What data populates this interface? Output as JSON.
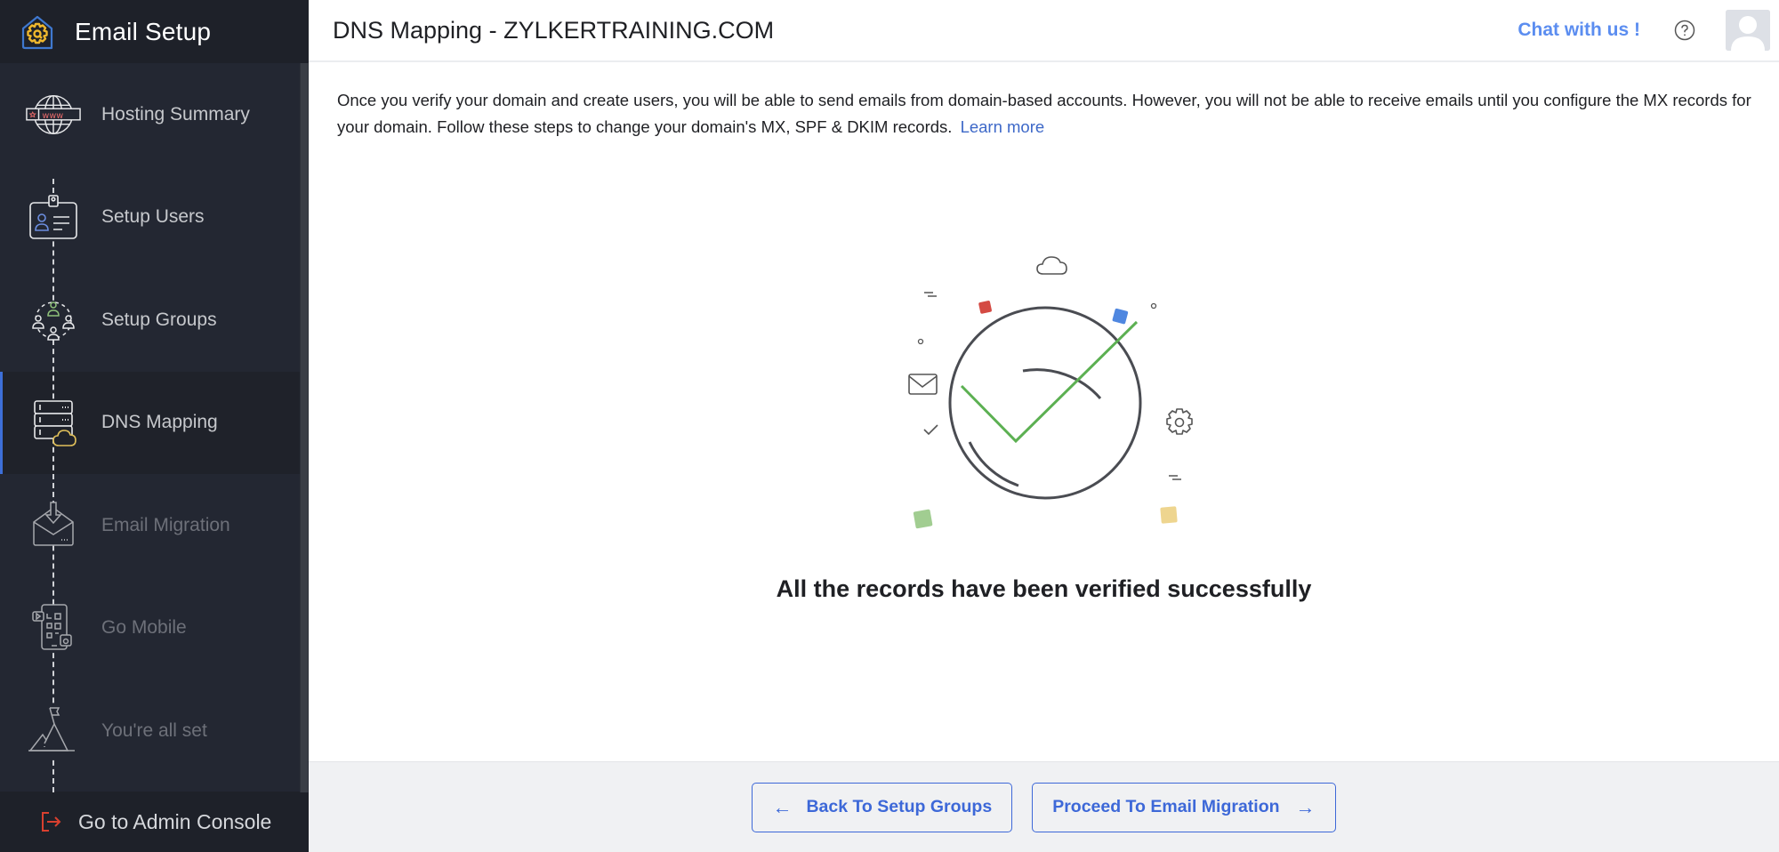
{
  "sidebar": {
    "title": "Email Setup",
    "logo_icon": "settings-home-icon",
    "steps": [
      {
        "label": "Hosting Summary",
        "icon": "globe-www-icon",
        "state": "done"
      },
      {
        "label": "Setup Users",
        "icon": "id-card-icon",
        "state": "done"
      },
      {
        "label": "Setup Groups",
        "icon": "group-users-icon",
        "state": "done"
      },
      {
        "label": "DNS Mapping",
        "icon": "server-cloud-icon",
        "state": "active"
      },
      {
        "label": "Email Migration",
        "icon": "envelope-download-icon",
        "state": "disabled"
      },
      {
        "label": "Go Mobile",
        "icon": "mobile-apps-icon",
        "state": "disabled"
      },
      {
        "label": "You're all set",
        "icon": "mountain-flag-icon",
        "state": "disabled"
      }
    ],
    "footer": {
      "label": "Go to Admin Console",
      "icon": "exit-icon"
    }
  },
  "header": {
    "title": "DNS Mapping - ZYLKERTRAINING.COM",
    "chat_label": "Chat with us !",
    "help_icon": "question-circle-icon",
    "avatar_icon": "user-avatar-icon"
  },
  "content": {
    "description": "Once you verify your domain and create users, you will be able to send emails from domain-based accounts. However, you will not be able to receive emails until you configure the MX records for your domain. Follow these steps to change your domain's MX, SPF & DKIM records.",
    "learn_more": "Learn more",
    "success_message": "All the records have been verified successfully"
  },
  "footer": {
    "back_label": "Back To Setup Groups",
    "back_arrow": "←",
    "next_label": "Proceed To Email Migration",
    "next_arrow": "→"
  },
  "colors": {
    "accent": "#3d68d8",
    "chat": "#5b8df0",
    "success_green": "#5cb052",
    "sidebar_bg": "#232732"
  }
}
